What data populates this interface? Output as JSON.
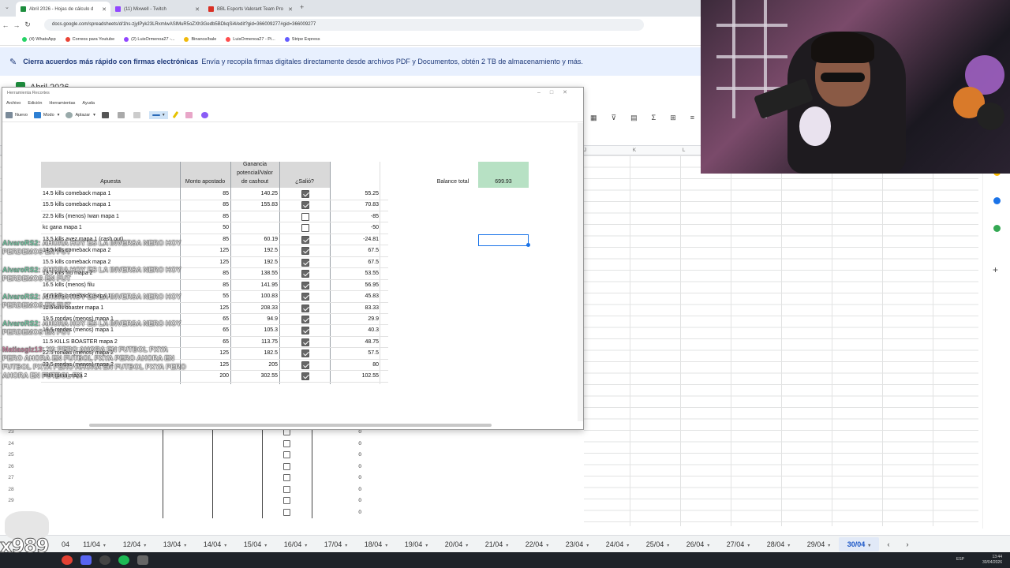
{
  "browser": {
    "tabs": [
      {
        "title": "Abril 2026 - Hojas de cálculo d",
        "active": true,
        "color": "#1e8e3e"
      },
      {
        "title": "(11) Mixwell - Twitch",
        "active": false,
        "color": "#9146ff"
      },
      {
        "title": "BBL Esports Valorant Team Pro",
        "active": false,
        "color": "#d93025"
      }
    ],
    "new_tab": "+",
    "url": "docs.google.com/spreadsheets/d/1hs-zjyIPyk23LRxmIwASlMuR5oZXh3Gedb5BDkqSi4/edit?gid=366009277#gid=366009277",
    "bookmarks": [
      {
        "label": "(4) WhatsApp",
        "color": "#25d366"
      },
      {
        "label": "Correos para Youtube",
        "color": "#ea4335"
      },
      {
        "label": "(2) LuisOrmenoa27 -...",
        "color": "#9146ff"
      },
      {
        "label": "Binance/bale",
        "color": "#f0b90b"
      },
      {
        "label": "LuisOrmenoa27 - Pi...",
        "color": "#ff4d4d"
      },
      {
        "label": "Stripe Express",
        "color": "#635bff"
      }
    ]
  },
  "banner": {
    "bold": "Cierra acuerdos más rápido con firmas electrónicas",
    "text": "Envía y recopila firmas digitales directamente desde archivos PDF y Documentos, obtén 2 TB de almacenamiento y más."
  },
  "sheets": {
    "doc_title": "Abril 2026",
    "columns": [
      {
        "l": "J"
      },
      {
        "l": "K"
      },
      {
        "l": "L"
      }
    ],
    "bg_rows": [
      {
        "n": "23",
        "v": "0"
      },
      {
        "n": "24",
        "v": "0"
      },
      {
        "n": "25",
        "v": "0"
      },
      {
        "n": "26",
        "v": "0"
      },
      {
        "n": "27",
        "v": "0"
      },
      {
        "n": "28",
        "v": "0"
      },
      {
        "n": "29",
        "v": "0"
      },
      {
        "n": "",
        "v": "0"
      }
    ],
    "sheet_tabs": [
      "04",
      "11/04",
      "12/04",
      "13/04",
      "14/04",
      "15/04",
      "16/04",
      "17/04",
      "18/04",
      "19/04",
      "20/04",
      "21/04",
      "22/04",
      "23/04",
      "24/04",
      "25/04",
      "26/04",
      "27/04",
      "28/04",
      "29/04",
      "30/04"
    ],
    "active_tab": "30/04"
  },
  "snip": {
    "title": "Herramienta Recortes",
    "menu": [
      "Archivo",
      "Edición",
      "Herramientas",
      "Ayuda"
    ],
    "toolbar": {
      "nuevo": "Nuevo",
      "modo": "Modo",
      "aplazar": "Aplazar"
    }
  },
  "table": {
    "headers": {
      "apuesta": "Apuesta",
      "monto": "Monto apostado",
      "ganancia_1": "Ganancia",
      "ganancia_2": "potencial/Valor",
      "ganancia_3": "de cashout",
      "salio": "¿Salió?"
    },
    "balance_label": "Balance total",
    "balance_value": "699.93",
    "rows": [
      {
        "a": "14.5 kills comeback mapa 1",
        "m": "85",
        "g": "140.25",
        "c": true,
        "p": "55.25"
      },
      {
        "a": "15.5 kills comeback mapa 1",
        "m": "85",
        "g": "155.83",
        "c": true,
        "p": "70.83"
      },
      {
        "a": "22.5 kills (menos) Iwan mapa 1",
        "m": "85",
        "g": "",
        "c": false,
        "p": "-85"
      },
      {
        "a": "kc gana mapa 1",
        "m": "50",
        "g": "",
        "c": false,
        "p": "-50"
      },
      {
        "a": "13.5 kills avez mapa 1 (cash out)",
        "m": "85",
        "g": "60.19",
        "c": true,
        "p": "-24.81"
      },
      {
        "a": "14.5 kills comeback mapa 2",
        "m": "125",
        "g": "192.5",
        "c": true,
        "p": "67.5"
      },
      {
        "a": "15.5 kills comeback mapa 2",
        "m": "125",
        "g": "192.5",
        "c": true,
        "p": "67.5"
      },
      {
        "a": "13.5 kills filu mapa 2",
        "m": "85",
        "g": "138.55",
        "c": true,
        "p": "53.55"
      },
      {
        "a": "16.5 kills (menos) filu",
        "m": "85",
        "g": "141.95",
        "c": true,
        "p": "56.95"
      },
      {
        "a": "14.5 kills comeback mapa 1",
        "m": "55",
        "g": "100.83",
        "c": true,
        "p": "45.83"
      },
      {
        "a": "11.5 kills boaster mapa 1",
        "m": "125",
        "g": "208.33",
        "c": true,
        "p": "83.33"
      },
      {
        "a": "19.5 rondas (menos) mapa 1",
        "m": "65",
        "g": "94.9",
        "c": true,
        "p": "29.9"
      },
      {
        "a": "18.5 rondas (menos) mapa 1",
        "m": "65",
        "g": "105.3",
        "c": true,
        "p": "40.3"
      },
      {
        "a": "11.5 KILLS BOASTER mapa 2",
        "m": "65",
        "g": "113.75",
        "c": true,
        "p": "48.75"
      },
      {
        "a": "22.5 rondas (menos) mapa 2",
        "m": "125",
        "g": "182.5",
        "c": true,
        "p": "57.5"
      },
      {
        "a": "23.5 rondas (menos) mapa 2",
        "m": "125",
        "g": "205",
        "c": true,
        "p": "80"
      },
      {
        "a": "mibr gana mapa 2",
        "m": "200",
        "g": "302.55",
        "c": true,
        "p": "102.55"
      }
    ]
  },
  "chat": [
    {
      "user": "AlvaroRS2",
      "msg": ": AHORA HOY ES LA INVERSA NERO HOY",
      "cont": "PERDEMOS EN FUT"
    },
    {
      "user": "AlvaroRS2",
      "msg": ": AHORA HOY ES LA INVERSA NERO HOY",
      "cont": "PERDEMOS EN FUT"
    },
    {
      "user": "AlvaroRS2",
      "msg": ": AHORA HOY ES LA INVERSA NERO HOY",
      "cont": "PERDEMOS EN FUT"
    },
    {
      "user": "AlvaroRS2",
      "msg": ": AHORA HOY ES LA INVERSA NERO HOY",
      "cont": "PERDEMOS EN FUT"
    }
  ],
  "chat2": {
    "user": "Matiasgiz13",
    "msg": ": YA PERO AHORA EN FUTBOL PXYA",
    "l2": "PERO AHORA EN FUTBOL PXYA PERO AHORA EN",
    "l3": "FUTBOL PXYA PERO AHORA EN FUTBOL PXYA PERO",
    "l4": "AHORA EN FUTBOL PX"
  },
  "overlay_logo": "x989",
  "tray": {
    "time": "13:44",
    "date": "30/04/2026",
    "lang": "ESP"
  },
  "colors": {
    "accent": "#1a73e8",
    "sheets_green": "#1e8e3e",
    "balance_bg": "#b7e1c4"
  }
}
